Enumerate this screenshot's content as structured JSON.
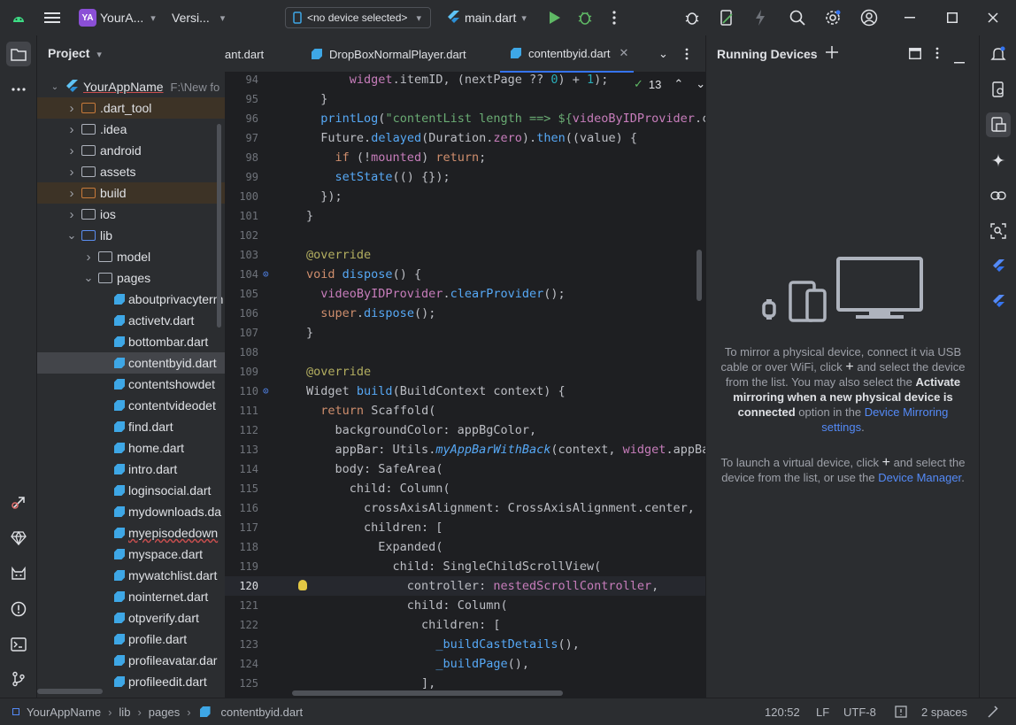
{
  "titlebar": {
    "project_badge": "YA",
    "project_name": "YourA...",
    "vcs_label": "Versi...",
    "device_selector": "<no device selected>",
    "run_config": "main.dart"
  },
  "project_panel": {
    "title": "Project",
    "root_name": "YourAppName",
    "root_path": "F:\\New fo",
    "items": [
      {
        "label": ".dart_tool",
        "type": "folder-orange",
        "level": 1,
        "expand": "right",
        "hl": true
      },
      {
        "label": ".idea",
        "type": "folder",
        "level": 1,
        "expand": "right"
      },
      {
        "label": "android",
        "type": "folder",
        "level": 1,
        "expand": "right"
      },
      {
        "label": "assets",
        "type": "folder",
        "level": 1,
        "expand": "right"
      },
      {
        "label": "build",
        "type": "folder-orange",
        "level": 1,
        "expand": "right",
        "hl": true
      },
      {
        "label": "ios",
        "type": "folder",
        "level": 1,
        "expand": "right"
      },
      {
        "label": "lib",
        "type": "folder-blue",
        "level": 1,
        "expand": "down"
      },
      {
        "label": "model",
        "type": "folder",
        "level": 2,
        "expand": "right"
      },
      {
        "label": "pages",
        "type": "folder",
        "level": 2,
        "expand": "down"
      },
      {
        "label": "aboutprivacyterm",
        "type": "dart",
        "level": 3
      },
      {
        "label": "activetv.dart",
        "type": "dart",
        "level": 3
      },
      {
        "label": "bottombar.dart",
        "type": "dart",
        "level": 3
      },
      {
        "label": "contentbyid.dart",
        "type": "dart",
        "level": 3,
        "sel": true
      },
      {
        "label": "contentshowdet",
        "type": "dart",
        "level": 3
      },
      {
        "label": "contentvideodet",
        "type": "dart",
        "level": 3
      },
      {
        "label": "find.dart",
        "type": "dart",
        "level": 3
      },
      {
        "label": "home.dart",
        "type": "dart",
        "level": 3
      },
      {
        "label": "intro.dart",
        "type": "dart",
        "level": 3
      },
      {
        "label": "loginsocial.dart",
        "type": "dart",
        "level": 3
      },
      {
        "label": "mydownloads.da",
        "type": "dart",
        "level": 3
      },
      {
        "label": "myepisodedown",
        "type": "dart",
        "level": 3
      },
      {
        "label": "myspace.dart",
        "type": "dart",
        "level": 3
      },
      {
        "label": "mywatchlist.dart",
        "type": "dart",
        "level": 3
      },
      {
        "label": "nointernet.dart",
        "type": "dart",
        "level": 3
      },
      {
        "label": "otpverify.dart",
        "type": "dart",
        "level": 3
      },
      {
        "label": "profile.dart",
        "type": "dart",
        "level": 3
      },
      {
        "label": "profileavatar.dar",
        "type": "dart",
        "level": 3
      },
      {
        "label": "profileedit.dart",
        "type": "dart",
        "level": 3
      }
    ]
  },
  "tabs": [
    {
      "label": "ant.dart"
    },
    {
      "label": "DropBoxNormalPlayer.dart"
    },
    {
      "label": "contentbyid.dart",
      "active": true
    }
  ],
  "editor": {
    "inspection_count": "13",
    "current_line": 120,
    "lines": [
      {
        "n": "94",
        "t": "      widget.itemID, (nextPage ?? 0) + 1);"
      },
      {
        "n": "95",
        "t": "  }"
      },
      {
        "n": "96",
        "t": "  printLog(\"contentList length ==> ${videoByIDProvider.co"
      },
      {
        "n": "97",
        "t": "  Future.delayed(Duration.zero).then((value) {"
      },
      {
        "n": "98",
        "t": "    if (!mounted) return;"
      },
      {
        "n": "99",
        "t": "    setState(() {});"
      },
      {
        "n": "100",
        "t": "  });"
      },
      {
        "n": "101",
        "t": "}"
      },
      {
        "n": "102",
        "t": ""
      },
      {
        "n": "103",
        "t": "@override"
      },
      {
        "n": "104",
        "t": "void dispose() {"
      },
      {
        "n": "105",
        "t": "  videoByIDProvider.clearProvider();"
      },
      {
        "n": "106",
        "t": "  super.dispose();"
      },
      {
        "n": "107",
        "t": "}"
      },
      {
        "n": "108",
        "t": ""
      },
      {
        "n": "109",
        "t": "@override"
      },
      {
        "n": "110",
        "t": "Widget build(BuildContext context) {"
      },
      {
        "n": "111",
        "t": "  return Scaffold("
      },
      {
        "n": "112",
        "t": "    backgroundColor: appBgColor,"
      },
      {
        "n": "113",
        "t": "    appBar: Utils.myAppBarWithBack(context, widget.appBar"
      },
      {
        "n": "114",
        "t": "    body: SafeArea("
      },
      {
        "n": "115",
        "t": "      child: Column("
      },
      {
        "n": "116",
        "t": "        crossAxisAlignment: CrossAxisAlignment.center,"
      },
      {
        "n": "117",
        "t": "        children: ["
      },
      {
        "n": "118",
        "t": "          Expanded("
      },
      {
        "n": "119",
        "t": "            child: SingleChildScrollView("
      },
      {
        "n": "120",
        "t": "              controller: nestedScrollController,"
      },
      {
        "n": "121",
        "t": "              child: Column("
      },
      {
        "n": "122",
        "t": "                children: ["
      },
      {
        "n": "123",
        "t": "                  _buildCastDetails(),"
      },
      {
        "n": "124",
        "t": "                  _buildPage(),"
      },
      {
        "n": "125",
        "t": "                ],"
      }
    ]
  },
  "running_devices": {
    "title": "Running Devices",
    "msg1_a": "To mirror a physical device, connect it via USB cable or over WiFi, click",
    "msg1_b": "and select the device from the list. You may also select the",
    "msg1_bold": "Activate mirroring when a new physical device is connected",
    "msg1_c": "option in the",
    "msg1_link": "Device Mirroring settings",
    "msg2_a": "To launch a virtual device, click",
    "msg2_b": "and select the device from the list, or use the",
    "msg2_link": "Device Manager"
  },
  "statusbar": {
    "crumbs": [
      "YourAppName",
      "lib",
      "pages",
      "contentbyid.dart"
    ],
    "position": "120:52",
    "line_sep": "LF",
    "encoding": "UTF-8",
    "indent": "2 spaces"
  }
}
